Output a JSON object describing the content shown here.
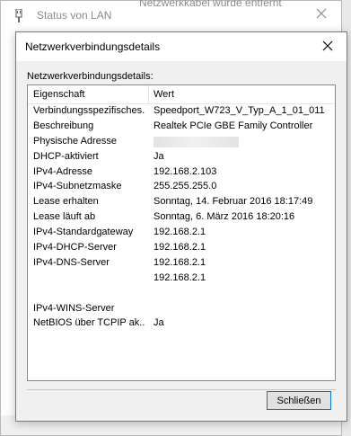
{
  "background_window": {
    "title": "Status von LAN",
    "partial_text": "Netzwerkkabel wurde entfernt"
  },
  "dialog": {
    "title": "Netzwerkverbindungsdetails",
    "section_label": "Netzwerkverbindungsdetails:",
    "columns": {
      "property": "Eigenschaft",
      "value": "Wert"
    },
    "rows": [
      {
        "key": "Verbindungsspezifisches...",
        "value": "Speedport_W723_V_Typ_A_1_01_011"
      },
      {
        "key": "Beschreibung",
        "value": "Realtek PCIe GBE Family Controller"
      },
      {
        "key": "Physische Adresse",
        "value": ""
      },
      {
        "key": "DHCP-aktiviert",
        "value": "Ja"
      },
      {
        "key": "IPv4-Adresse",
        "value": "192.168.2.103"
      },
      {
        "key": "IPv4-Subnetzmaske",
        "value": "255.255.255.0"
      },
      {
        "key": "Lease erhalten",
        "value": "Sonntag, 14. Februar 2016 18:17:49"
      },
      {
        "key": "Lease läuft ab",
        "value": "Sonntag, 6. März 2016 18:20:16"
      },
      {
        "key": "IPv4-Standardgateway",
        "value": "192.168.2.1"
      },
      {
        "key": "IPv4-DHCP-Server",
        "value": "192.168.2.1"
      },
      {
        "key": "IPv4-DNS-Server",
        "value": "192.168.2.1"
      },
      {
        "key": "",
        "value": "192.168.2.1"
      },
      {
        "key": "",
        "value": ""
      },
      {
        "key": "IPv4-WINS-Server",
        "value": ""
      },
      {
        "key": "NetBIOS über TCPIP ak...",
        "value": "Ja"
      }
    ],
    "close_button": "Schließen"
  },
  "colors": {
    "accent": "#0078d7",
    "dialog_bg": "#f0f0f0",
    "border": "#828790"
  }
}
